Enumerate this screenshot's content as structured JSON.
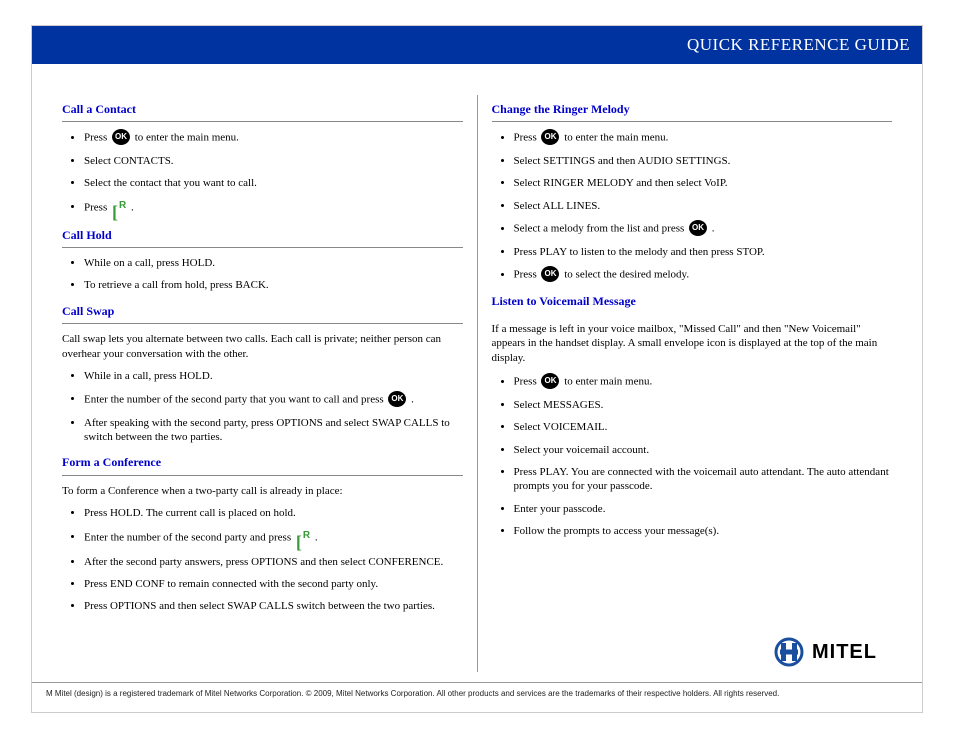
{
  "header": {
    "title": "QUICK REFERENCE GUIDE"
  },
  "left": {
    "callContact": {
      "title": "Call a Contact",
      "s1a": "Press ",
      "s1b": " to enter the main menu.",
      "s2": "Select CONTACTS.",
      "s3": "Select the contact that you want to call.",
      "s4a": "Press ",
      "s4b": "."
    },
    "callHold": {
      "title": "Call Hold",
      "s1": "While on a call, press HOLD.",
      "s2": "To retrieve a call from hold, press BACK."
    },
    "callSwap": {
      "title": "Call Swap",
      "intro": "Call swap lets you alternate between two calls. Each call is private; neither person can overhear your conversation with the other.",
      "s1": "While in a call, press HOLD.",
      "s2a": "Enter the number of the second party that you want to call and press ",
      "s2b": ".",
      "s3": "After speaking with the second party, press OPTIONS and select SWAP CALLS to switch between the two parties."
    },
    "conference": {
      "title": "Form a Conference",
      "intro": "To form a Conference when a two-party call is already in place:",
      "s1": "Press HOLD. The current call is placed on hold.",
      "s2a": "Enter the number of the second party and press ",
      "s2b": ".",
      "s3": "After the second party answers, press OPTIONS and then select CONFERENCE.",
      "s4": "Press END CONF to remain connected with the second party only.",
      "s5": "Press OPTIONS and then select SWAP CALLS switch between the two parties."
    }
  },
  "right": {
    "ringer": {
      "title": "Change the Ringer Melody",
      "s1a": "Press ",
      "s1b": " to enter the main menu.",
      "s2": "Select SETTINGS and then AUDIO SETTINGS.",
      "s3": "Select RINGER MELODY and then select VoIP.",
      "s4": "Select ALL LINES.",
      "s5a": "Select a melody from the list and press ",
      "s5b": ".",
      "s6": "Press PLAY to listen to the melody and then press STOP.",
      "s7a": "Press ",
      "s7b": " to select the desired melody."
    },
    "voicemail": {
      "title": "Listen to Voicemail Message",
      "intro": "If a message is left in your voice mailbox, \"Missed Call\" and then \"New Voicemail\" appears in the handset display. A small envelope icon is displayed at the top of the main display.",
      "s1a": "Press ",
      "s1b": " to enter main menu.",
      "s2": "Select MESSAGES.",
      "s3": "Select VOICEMAIL.",
      "s4": "Select your voicemail account.",
      "s5": "Press PLAY. You are connected with the voicemail auto attendant. The auto attendant prompts you for your passcode.",
      "s6": "Enter your passcode.",
      "s7": "Follow the prompts to access your message(s)."
    }
  },
  "logo": {
    "text": "MITEL"
  },
  "footer": {
    "text": "M Mitel (design) is a registered trademark of Mitel Networks Corporation. © 2009, Mitel Networks Corporation. All other products and services are the trademarks of their respective holders. All rights reserved."
  },
  "icons": {
    "ok": "OK",
    "rBracket": "[",
    "rLetter": "R"
  }
}
